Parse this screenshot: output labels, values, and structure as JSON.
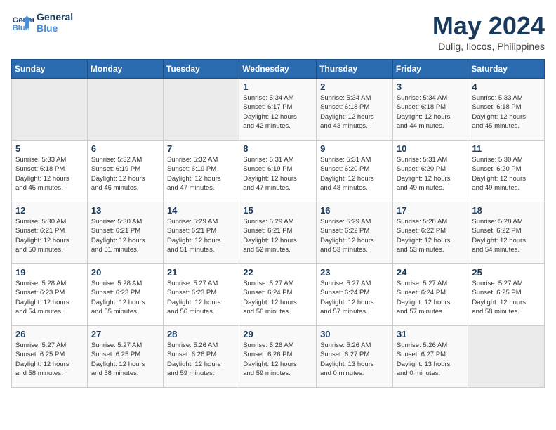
{
  "logo": {
    "line1": "General",
    "line2": "Blue"
  },
  "title": "May 2024",
  "subtitle": "Dulig, Ilocos, Philippines",
  "days_of_week": [
    "Sunday",
    "Monday",
    "Tuesday",
    "Wednesday",
    "Thursday",
    "Friday",
    "Saturday"
  ],
  "weeks": [
    [
      {
        "day": "",
        "info": ""
      },
      {
        "day": "",
        "info": ""
      },
      {
        "day": "",
        "info": ""
      },
      {
        "day": "1",
        "info": "Sunrise: 5:34 AM\nSunset: 6:17 PM\nDaylight: 12 hours\nand 42 minutes."
      },
      {
        "day": "2",
        "info": "Sunrise: 5:34 AM\nSunset: 6:18 PM\nDaylight: 12 hours\nand 43 minutes."
      },
      {
        "day": "3",
        "info": "Sunrise: 5:34 AM\nSunset: 6:18 PM\nDaylight: 12 hours\nand 44 minutes."
      },
      {
        "day": "4",
        "info": "Sunrise: 5:33 AM\nSunset: 6:18 PM\nDaylight: 12 hours\nand 45 minutes."
      }
    ],
    [
      {
        "day": "5",
        "info": "Sunrise: 5:33 AM\nSunset: 6:18 PM\nDaylight: 12 hours\nand 45 minutes."
      },
      {
        "day": "6",
        "info": "Sunrise: 5:32 AM\nSunset: 6:19 PM\nDaylight: 12 hours\nand 46 minutes."
      },
      {
        "day": "7",
        "info": "Sunrise: 5:32 AM\nSunset: 6:19 PM\nDaylight: 12 hours\nand 47 minutes."
      },
      {
        "day": "8",
        "info": "Sunrise: 5:31 AM\nSunset: 6:19 PM\nDaylight: 12 hours\nand 47 minutes."
      },
      {
        "day": "9",
        "info": "Sunrise: 5:31 AM\nSunset: 6:20 PM\nDaylight: 12 hours\nand 48 minutes."
      },
      {
        "day": "10",
        "info": "Sunrise: 5:31 AM\nSunset: 6:20 PM\nDaylight: 12 hours\nand 49 minutes."
      },
      {
        "day": "11",
        "info": "Sunrise: 5:30 AM\nSunset: 6:20 PM\nDaylight: 12 hours\nand 49 minutes."
      }
    ],
    [
      {
        "day": "12",
        "info": "Sunrise: 5:30 AM\nSunset: 6:21 PM\nDaylight: 12 hours\nand 50 minutes."
      },
      {
        "day": "13",
        "info": "Sunrise: 5:30 AM\nSunset: 6:21 PM\nDaylight: 12 hours\nand 51 minutes."
      },
      {
        "day": "14",
        "info": "Sunrise: 5:29 AM\nSunset: 6:21 PM\nDaylight: 12 hours\nand 51 minutes."
      },
      {
        "day": "15",
        "info": "Sunrise: 5:29 AM\nSunset: 6:21 PM\nDaylight: 12 hours\nand 52 minutes."
      },
      {
        "day": "16",
        "info": "Sunrise: 5:29 AM\nSunset: 6:22 PM\nDaylight: 12 hours\nand 53 minutes."
      },
      {
        "day": "17",
        "info": "Sunrise: 5:28 AM\nSunset: 6:22 PM\nDaylight: 12 hours\nand 53 minutes."
      },
      {
        "day": "18",
        "info": "Sunrise: 5:28 AM\nSunset: 6:22 PM\nDaylight: 12 hours\nand 54 minutes."
      }
    ],
    [
      {
        "day": "19",
        "info": "Sunrise: 5:28 AM\nSunset: 6:23 PM\nDaylight: 12 hours\nand 54 minutes."
      },
      {
        "day": "20",
        "info": "Sunrise: 5:28 AM\nSunset: 6:23 PM\nDaylight: 12 hours\nand 55 minutes."
      },
      {
        "day": "21",
        "info": "Sunrise: 5:27 AM\nSunset: 6:23 PM\nDaylight: 12 hours\nand 56 minutes."
      },
      {
        "day": "22",
        "info": "Sunrise: 5:27 AM\nSunset: 6:24 PM\nDaylight: 12 hours\nand 56 minutes."
      },
      {
        "day": "23",
        "info": "Sunrise: 5:27 AM\nSunset: 6:24 PM\nDaylight: 12 hours\nand 57 minutes."
      },
      {
        "day": "24",
        "info": "Sunrise: 5:27 AM\nSunset: 6:24 PM\nDaylight: 12 hours\nand 57 minutes."
      },
      {
        "day": "25",
        "info": "Sunrise: 5:27 AM\nSunset: 6:25 PM\nDaylight: 12 hours\nand 58 minutes."
      }
    ],
    [
      {
        "day": "26",
        "info": "Sunrise: 5:27 AM\nSunset: 6:25 PM\nDaylight: 12 hours\nand 58 minutes."
      },
      {
        "day": "27",
        "info": "Sunrise: 5:27 AM\nSunset: 6:25 PM\nDaylight: 12 hours\nand 58 minutes."
      },
      {
        "day": "28",
        "info": "Sunrise: 5:26 AM\nSunset: 6:26 PM\nDaylight: 12 hours\nand 59 minutes."
      },
      {
        "day": "29",
        "info": "Sunrise: 5:26 AM\nSunset: 6:26 PM\nDaylight: 12 hours\nand 59 minutes."
      },
      {
        "day": "30",
        "info": "Sunrise: 5:26 AM\nSunset: 6:27 PM\nDaylight: 13 hours\nand 0 minutes."
      },
      {
        "day": "31",
        "info": "Sunrise: 5:26 AM\nSunset: 6:27 PM\nDaylight: 13 hours\nand 0 minutes."
      },
      {
        "day": "",
        "info": ""
      }
    ]
  ]
}
